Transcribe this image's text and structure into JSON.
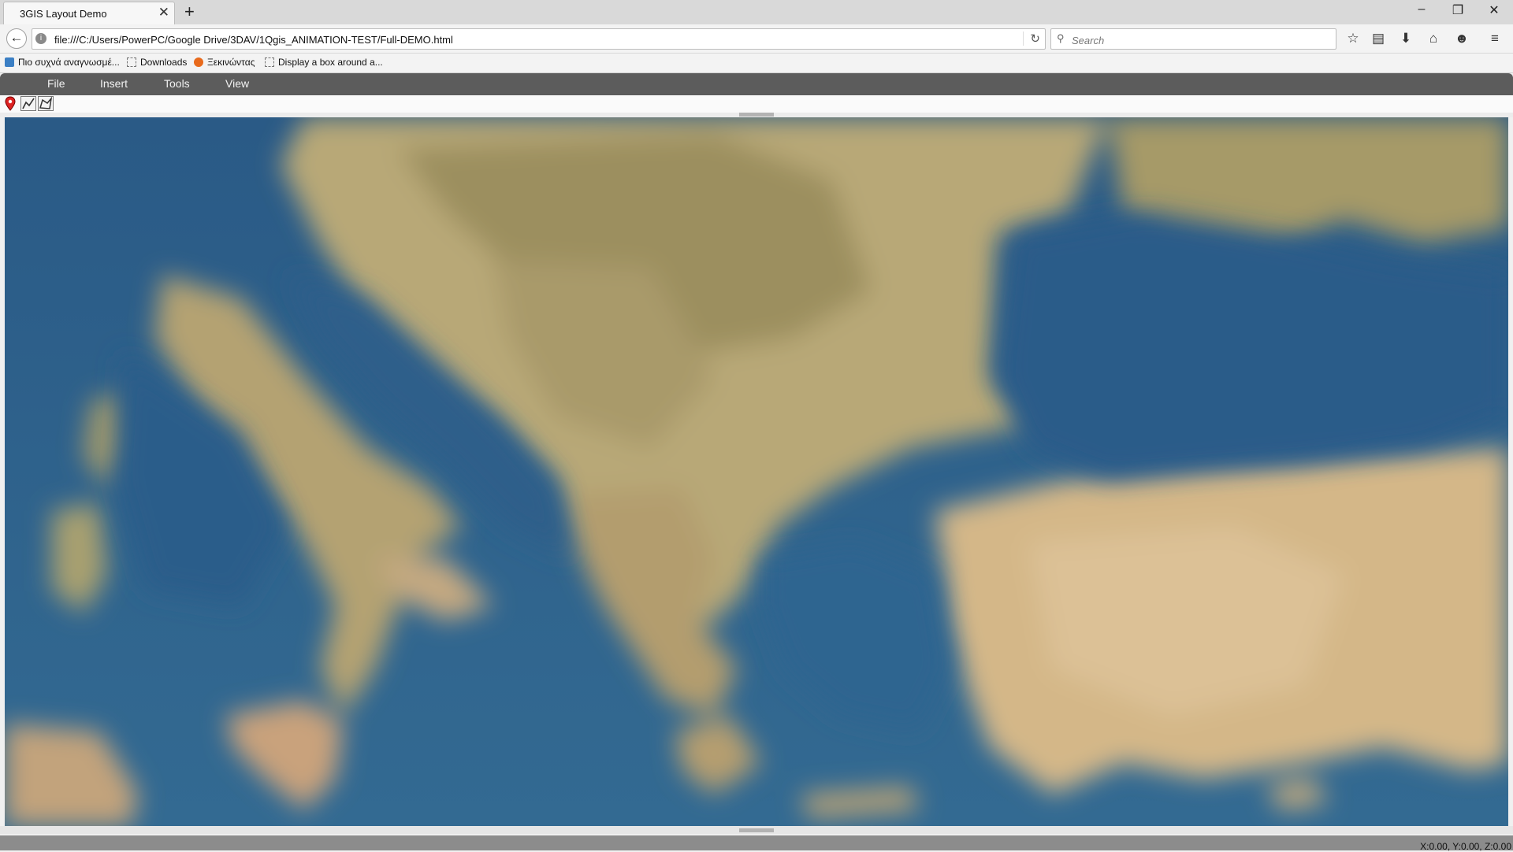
{
  "browser": {
    "tab_title": "3GIS Layout Demo",
    "url": "file:///C:/Users/PowerPC/Google Drive/3DAV/1Qgis_ANIMATION-TEST/Full-DEMO.html",
    "search_placeholder": "Search",
    "bookmarks": [
      "Πιο συχνά αναγνωσμέ...",
      "Downloads",
      "Ξεκινώντας",
      "Display a box around a..."
    ]
  },
  "app_menu": [
    "File",
    "Insert",
    "Tools",
    "View"
  ],
  "status": {
    "coords": "X:0.00, Y:0.00, Z:0.00"
  },
  "colors": {
    "sea": "#2d5f8a",
    "menu_bg": "#5c5c5c"
  }
}
